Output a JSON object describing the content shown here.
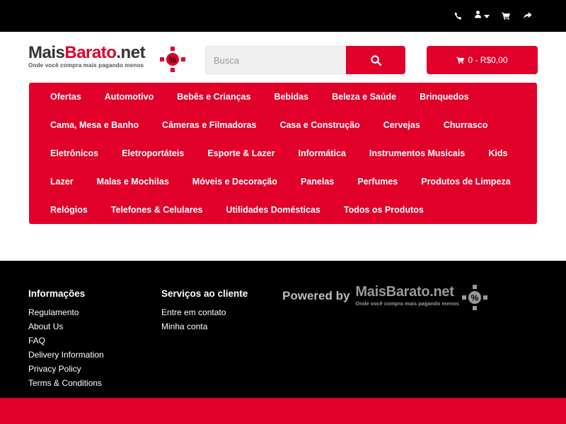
{
  "topbar": {
    "icons": [
      "phone-icon",
      "user-icon",
      "chevron-down-icon",
      "cart-icon",
      "share-icon"
    ]
  },
  "logo": {
    "brand_part1": "Mais",
    "brand_part2": "Barato",
    "brand_part3": ".net",
    "tagline": "Onde você compra mais pagando menos",
    "badge": "%"
  },
  "search": {
    "placeholder": "Busca",
    "button_icon": "search-icon"
  },
  "cart": {
    "label": "0 - R$0,00",
    "icon": "cart-icon"
  },
  "menu": {
    "rows": [
      [
        "Ofertas",
        "Automotivo",
        "Bebês e Crianças",
        "Bebidas",
        "Beleza e Saúde",
        "Brinquedos"
      ],
      [
        "Cama, Mesa e Banho",
        "Câmeras e Filmadoras",
        "Casa e Construção",
        "Cervejas",
        "Churrasco"
      ],
      [
        "Eletrônicos",
        "Eletroportáteis",
        "Esporte & Lazer",
        "Informática",
        "Instrumentos Musicais",
        "Kids"
      ],
      [
        "Lazer",
        "Malas e Mochilas",
        "Móveis e Decoração",
        "Panelas",
        "Perfumes",
        "Produtos de Limpeza"
      ],
      [
        "Relógios",
        "Telefones & Celulares",
        "Utilidades Domésticas",
        "Todos os Produtos"
      ]
    ]
  },
  "footer": {
    "col1": {
      "title": "Informações",
      "links": [
        "Regulamento",
        "About Us",
        "FAQ",
        "Delivery Information",
        "Privacy Policy",
        "Terms & Conditions"
      ]
    },
    "col2": {
      "title": "Serviços ao cliente",
      "links": [
        "Entre em contato",
        "Minha conta"
      ]
    },
    "powered": {
      "label": "Powered by",
      "brand": "MaisBarato.net",
      "tagline": "Onde você compra mais pagando menos",
      "badge": "%"
    }
  },
  "colors": {
    "accent": "#e0002a",
    "dark": "#000000"
  }
}
